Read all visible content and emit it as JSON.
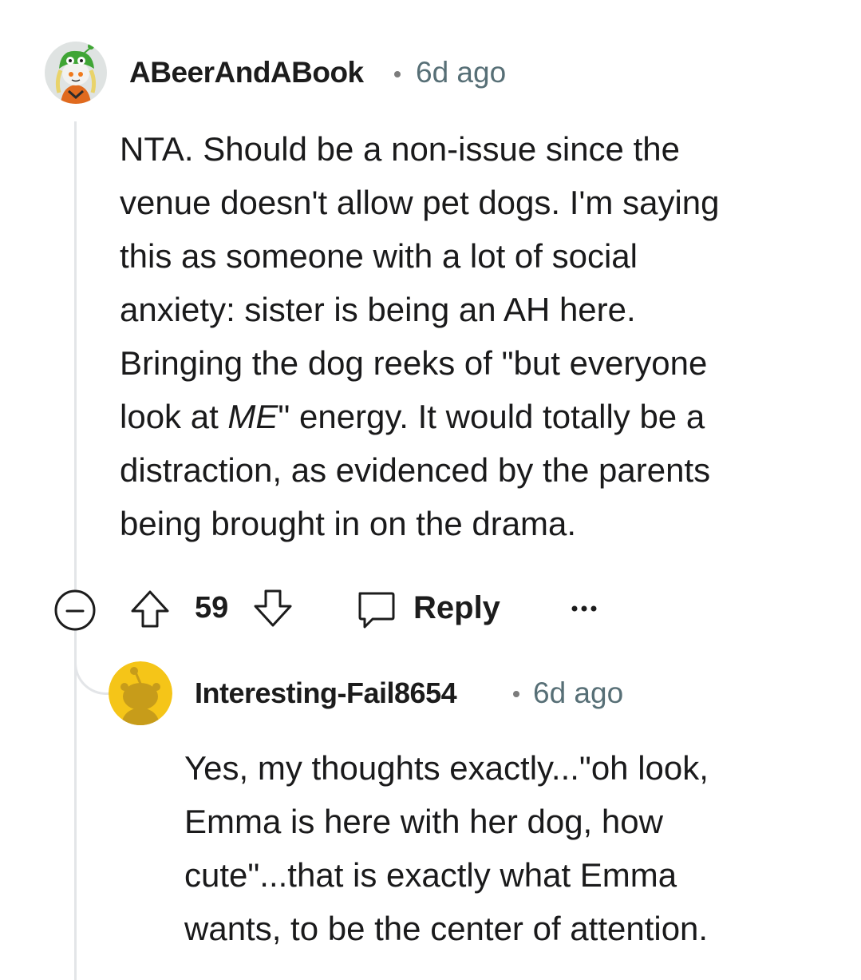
{
  "comment": {
    "author": "ABeerAndABook",
    "time": "6d ago",
    "body_lines": [
      "NTA.  Should be a non-issue since the",
      "venue doesn't allow pet dogs. I'm saying",
      "this as someone with a lot of social",
      "anxiety: sister is being an AH here.",
      "Bringing the dog reeks of \"but everyone"
    ],
    "body_line6_pre": "look at ",
    "body_line6_em": "ME",
    "body_line6_post": "\" energy. It would totally be a",
    "body_lines_tail": [
      "distraction, as evidenced by the parents",
      "being brought in on the drama."
    ],
    "votes": "59",
    "reply_label": "Reply",
    "icons": {
      "collapse": "collapse-minus-icon",
      "upvote": "upvote-arrow-icon",
      "downvote": "downvote-arrow-icon",
      "reply": "speech-bubble-icon",
      "more": "more-dots-icon"
    }
  },
  "reply": {
    "author": "Interesting-Fail8654",
    "time": "6d ago",
    "body_lines": [
      "Yes, my thoughts exactly...\"oh look,",
      "Emma is here with her dog, how",
      "cute\"...that is exactly what Emma",
      "wants, to be the center of attention."
    ]
  },
  "colors": {
    "thread_line": "#e3e5e8",
    "meta_gray": "#576f76",
    "text": "#1a1a1b",
    "avatar_yellow": "#f5c518"
  }
}
